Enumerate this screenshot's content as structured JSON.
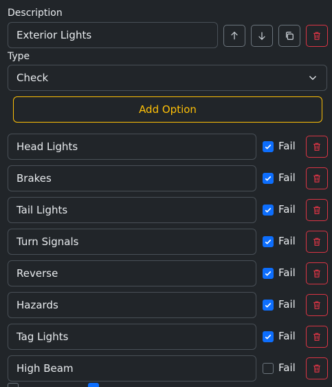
{
  "description": {
    "label": "Description",
    "value": "Exterior Lights"
  },
  "toolbar": {
    "move_up_icon": "arrow-up-icon",
    "move_down_icon": "arrow-down-icon",
    "duplicate_icon": "copy-icon",
    "delete_icon": "trash-icon"
  },
  "type": {
    "label": "Type",
    "selected": "Check"
  },
  "add_option": {
    "label": "Add Option"
  },
  "options": [
    {
      "value": "Head Lights",
      "fail_label": "Fail",
      "fail_checked": true
    },
    {
      "value": "Brakes",
      "fail_label": "Fail",
      "fail_checked": true
    },
    {
      "value": "Tail Lights",
      "fail_label": "Fail",
      "fail_checked": true
    },
    {
      "value": "Turn Signals",
      "fail_label": "Fail",
      "fail_checked": true
    },
    {
      "value": "Reverse",
      "fail_label": "Fail",
      "fail_checked": true
    },
    {
      "value": "Hazards",
      "fail_label": "Fail",
      "fail_checked": true
    },
    {
      "value": "Tag Lights",
      "fail_label": "Fail",
      "fail_checked": true
    },
    {
      "value": "High Beam",
      "fail_label": "Fail",
      "fail_checked": false
    }
  ],
  "colors": {
    "background": "#212529",
    "accent_warning": "#ffc107",
    "danger": "#dc3545",
    "checkbox_checked": "#0d6efd"
  }
}
